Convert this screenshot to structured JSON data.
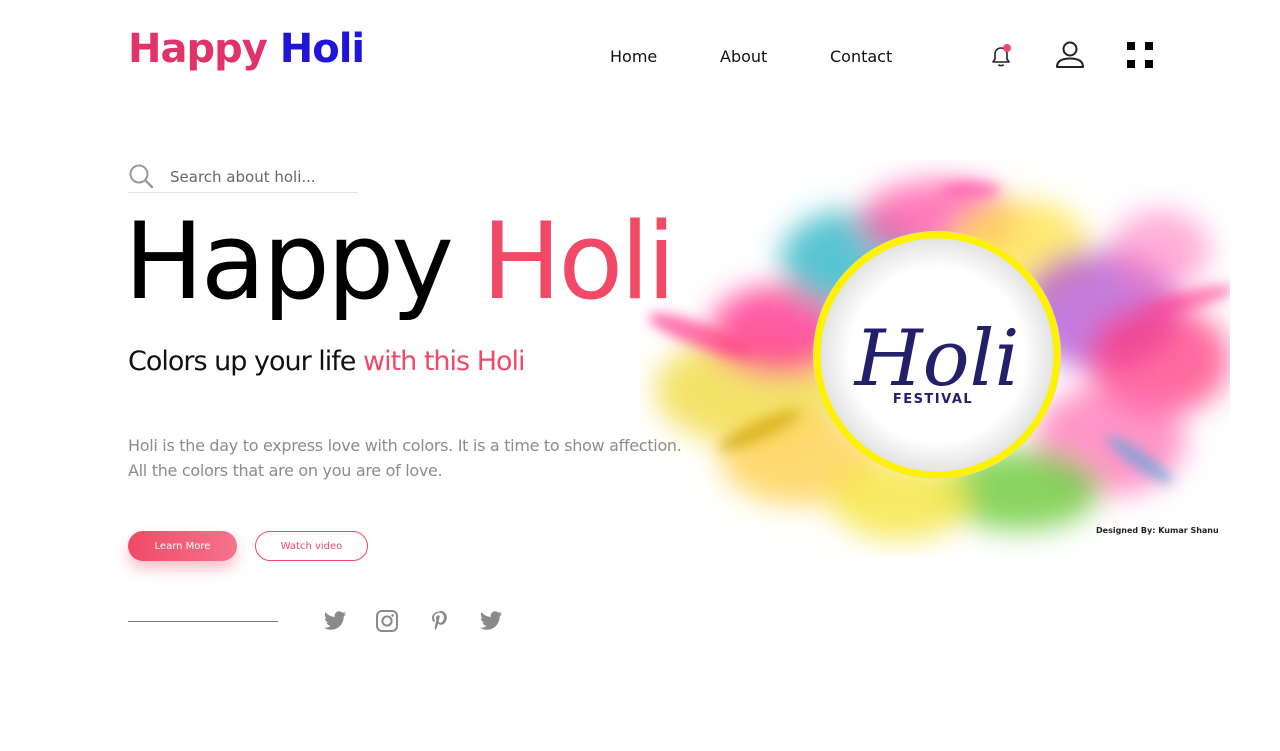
{
  "brand": {
    "word1": "Happy",
    "word2": "Holi"
  },
  "nav": {
    "home": "Home",
    "about": "About",
    "contact": "Contact"
  },
  "notification": {
    "badge_color": "#f04a67"
  },
  "search": {
    "placeholder": "Search about holi..."
  },
  "hero": {
    "title_word1": "Happy",
    "title_word2": "Holi",
    "subtitle_part1": "Colors up your life",
    "subtitle_part2": "with this Holi",
    "description_line1": "Holi is the day to express love with colors. It is a time to show affection.",
    "description_line2": "All the colors that are on you are of love.",
    "learn_more": "Learn More",
    "watch_video": "Watch video"
  },
  "artwork": {
    "script_text": "Holi",
    "festival_text": "FESTIVAL",
    "credit": "Designed By: Kumar Shanu"
  },
  "social": [
    "twitter-icon",
    "instagram-icon",
    "pinterest-icon",
    "twitter-icon"
  ],
  "colors": {
    "accent": "#f04a67",
    "brand_pink": "#e0336a",
    "brand_blue": "#1f14d8",
    "muted_text": "#8c8c8c",
    "ring_yellow": "#fff200",
    "script_navy": "#23206b"
  }
}
